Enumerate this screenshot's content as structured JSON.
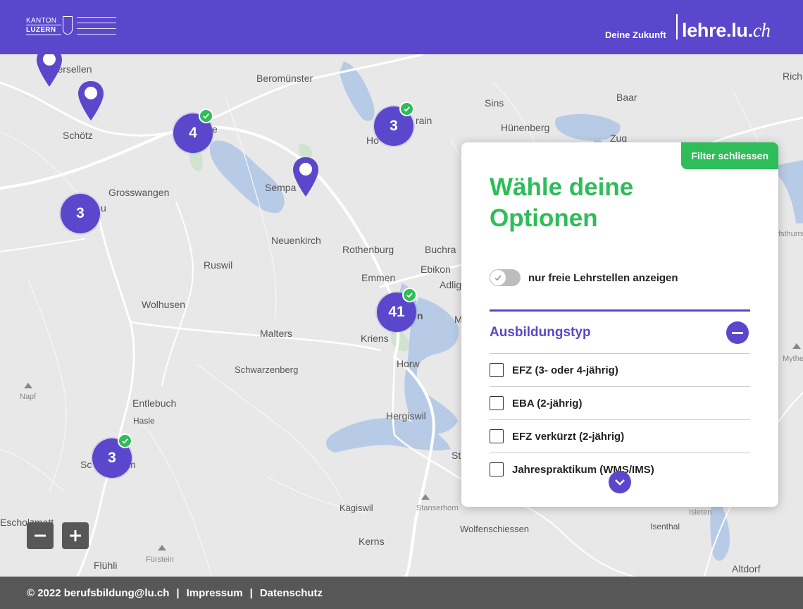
{
  "header": {
    "logo_line1": "KANTON",
    "logo_line2": "LUZERN",
    "tagline": "Deine Zukunft",
    "brand_main": "lehre.lu.",
    "brand_suffix": "ch"
  },
  "map": {
    "places": [
      {
        "id": "egmersellen",
        "label": "gmersellen"
      },
      {
        "id": "schoetz",
        "label": "Schötz"
      },
      {
        "id": "beromuenster",
        "label": "Beromünster"
      },
      {
        "id": "sins",
        "label": "Sins"
      },
      {
        "id": "baar",
        "label": "Baar"
      },
      {
        "id": "huenenberg",
        "label": "Hünenberg"
      },
      {
        "id": "zug",
        "label": "Zug"
      },
      {
        "id": "rich",
        "label": "Rich"
      },
      {
        "id": "hochdorf-partial",
        "label": "Ho"
      },
      {
        "id": "rain-partial",
        "label": "rain"
      },
      {
        "id": "sempach",
        "label": "Sempa"
      },
      {
        "id": "grosswangen",
        "label": "Grosswangen"
      },
      {
        "id": "neuenkirch",
        "label": "Neuenkirch"
      },
      {
        "id": "rothenburg",
        "label": "Rothenburg"
      },
      {
        "id": "buchrain",
        "label": "Buchra"
      },
      {
        "id": "ruswil",
        "label": "Ruswil"
      },
      {
        "id": "emmen",
        "label": "Emmen"
      },
      {
        "id": "ebikon",
        "label": "Ebikon"
      },
      {
        "id": "adligenswil",
        "label": "Adlig"
      },
      {
        "id": "wolhusen",
        "label": "Wolhusen"
      },
      {
        "id": "malters",
        "label": "Malters"
      },
      {
        "id": "kriens",
        "label": "Kriens"
      },
      {
        "id": "schwarzenberg",
        "label": "Schwarzenberg"
      },
      {
        "id": "horw",
        "label": "Horw"
      },
      {
        "id": "entlebuch",
        "label": "Entlebuch"
      },
      {
        "id": "hasle",
        "label": "Hasle"
      },
      {
        "id": "hergiswil",
        "label": "Hergiswil"
      },
      {
        "id": "schuepfheim-partial",
        "label": "Sc"
      },
      {
        "id": "schuepfheim-end",
        "label": "m"
      },
      {
        "id": "napf",
        "label": "Napf"
      },
      {
        "id": "mythen",
        "label": "Mythe"
      },
      {
        "id": "fsthurns",
        "label": "fsthurns"
      },
      {
        "id": "escholzmatt",
        "label": "Escholzmatt"
      },
      {
        "id": "kaegiswil",
        "label": "Kägiswil"
      },
      {
        "id": "stanserhorn",
        "label": "Stanserhorn"
      },
      {
        "id": "wolfenschiessen",
        "label": "Wolfenschiessen"
      },
      {
        "id": "isenthal",
        "label": "Isenthal"
      },
      {
        "id": "isleten",
        "label": "Isleten"
      },
      {
        "id": "kerns",
        "label": "Kerns"
      },
      {
        "id": "fuerstein",
        "label": "Fürstein"
      },
      {
        "id": "fluehli",
        "label": "Flühli"
      },
      {
        "id": "altdorf",
        "label": "Altdorf"
      },
      {
        "id": "st-partial",
        "label": "St"
      },
      {
        "id": "lu-partial",
        "label": "n"
      },
      {
        "id": "e-partial",
        "label": "e"
      },
      {
        "id": "u-partial",
        "label": "u"
      },
      {
        "id": "m-partial",
        "label": "M"
      }
    ],
    "clusters": [
      {
        "id": "cluster-4",
        "count": "4",
        "checked": true
      },
      {
        "id": "cluster-3-hochdorf",
        "count": "3",
        "checked": true
      },
      {
        "id": "cluster-3-west",
        "count": "3",
        "checked": false
      },
      {
        "id": "cluster-41",
        "count": "41",
        "checked": true
      },
      {
        "id": "cluster-3-south",
        "count": "3",
        "checked": true
      }
    ],
    "zoom_out_label": "−",
    "zoom_in_label": "+"
  },
  "filter": {
    "close_label": "Filter schliessen",
    "title": "Wähle deine Optionen",
    "toggle_label": "nur freie Lehrstellen anzeigen",
    "toggle_on": false,
    "section_title": "Ausbildungstyp",
    "options": [
      {
        "label": "EFZ (3- oder 4-jährig)",
        "checked": false
      },
      {
        "label": "EBA (2-jährig)",
        "checked": false
      },
      {
        "label": "EFZ verkürzt (2-jährig)",
        "checked": false
      },
      {
        "label": "Jahrespraktikum (WMS/IMS)",
        "checked": false
      }
    ]
  },
  "footer": {
    "copyright": "© 2022 berufsbildung@lu.ch",
    "sep": "|",
    "impressum": "Impressum",
    "datenschutz": "Datenschutz"
  },
  "colors": {
    "primary": "#5b47cb",
    "accent": "#2ebd59",
    "footer": "#575757",
    "water": "#b8cbe6"
  }
}
